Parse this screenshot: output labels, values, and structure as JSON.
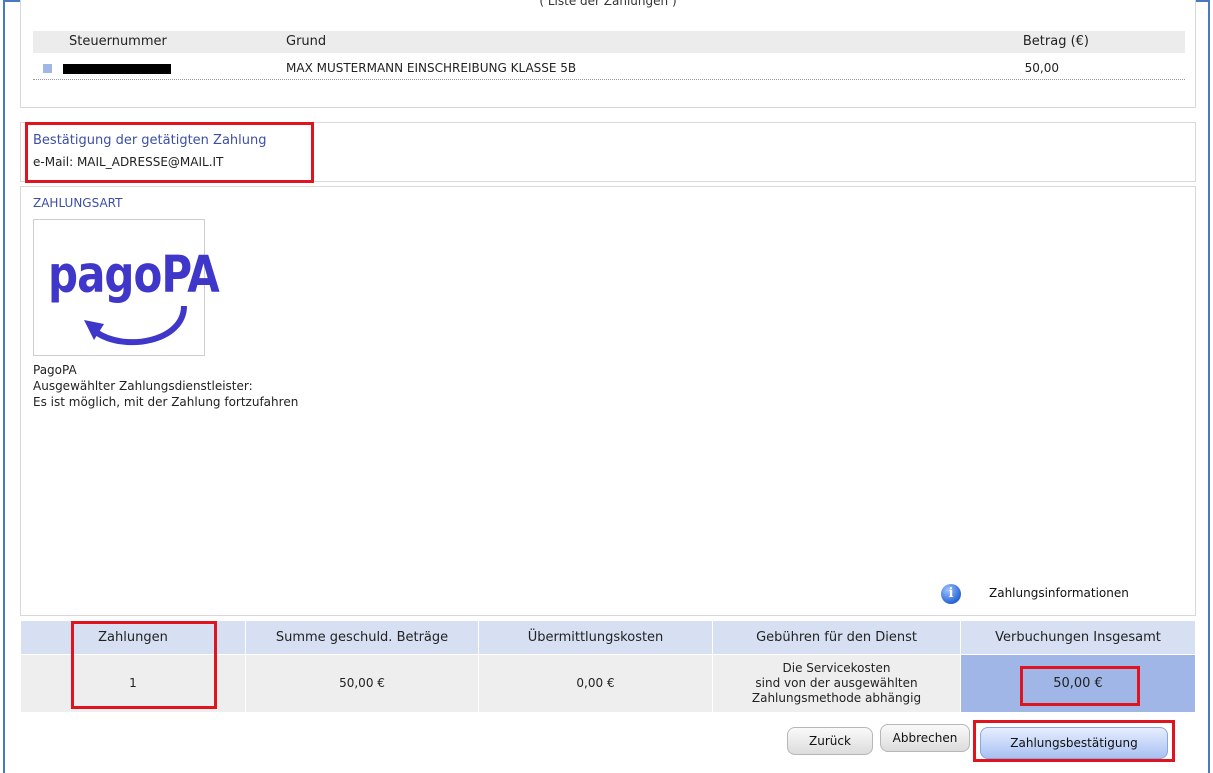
{
  "payments_list": {
    "caption": "( Liste der Zahlungen )",
    "headers": {
      "tax_number": "Steuernummer",
      "reason": "Grund",
      "amount": "Betrag (€)"
    },
    "rows": [
      {
        "tax_number": "",
        "reason": "MAX MUSTERMANN EINSCHREIBUNG KLASSE 5B",
        "amount": "50,00"
      }
    ]
  },
  "confirmation": {
    "title": "Bestätigung der getätigten Zahlung",
    "email_line": "e-Mail: MAIL_ADRESSE@MAIL.IT"
  },
  "payment_method": {
    "title": "ZAHLUNGSART",
    "logo_text": "pagoPA",
    "name": "PagoPA",
    "provider_line": "Ausgewählter Zahlungsdienstleister:",
    "status_line": "Es ist möglich, mit der Zahlung fortzufahren"
  },
  "info": {
    "label": "Zahlungsinformationen",
    "icon": "info-icon"
  },
  "summary": {
    "headers": [
      "Zahlungen",
      "Summe geschuld. Beträge",
      "Übermittlungskosten",
      "Gebühren für den Dienst",
      "Verbuchungen Insgesamt"
    ],
    "values": {
      "payments": "1",
      "sum_due": "50,00 €",
      "transmission_costs": "0,00 €",
      "service_fee_1": "Die Servicekosten",
      "service_fee_2": "sind von der ausgewählten",
      "service_fee_3": "Zahlungsmethode abhängig",
      "total": "50,00 €"
    }
  },
  "buttons": {
    "back": "Zurück",
    "cancel": "Abbrechen",
    "confirm": "Zahlungsbestätigung"
  },
  "colors": {
    "accent": "#3c4fa6",
    "highlight": "#e0141e",
    "header_bg": "#d6e0f2",
    "total_bg": "#9fb6e6",
    "frame": "#4a78c2"
  }
}
